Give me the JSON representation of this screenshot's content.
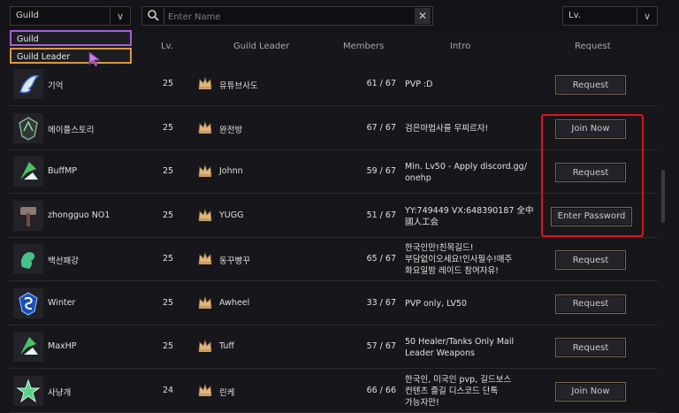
{
  "filter": {
    "selected": "Guild",
    "options": [
      "Guild",
      "Guild Leader"
    ]
  },
  "search": {
    "placeholder": "Enter Name"
  },
  "level_select": {
    "selected": "Lv."
  },
  "columns": {
    "lv": "Lv.",
    "leader": "Guild Leader",
    "members": "Members",
    "intro": "Intro",
    "request": "Request"
  },
  "rows": [
    {
      "name": "기억",
      "lv": "25",
      "leader": "유튜브사도",
      "members": "61 / 67",
      "intro": [
        "PVP :D"
      ],
      "button": "Request",
      "emblem": "dragon-emblem-icon"
    },
    {
      "name": "메이플스토리",
      "lv": "25",
      "leader": "완전방",
      "members": "67 / 67",
      "intro": [
        "검은마법사를 무찌르자!"
      ],
      "button": "Join Now",
      "emblem": "shield-emblem-icon"
    },
    {
      "name": "BuffMP",
      "lv": "25",
      "leader": "Johnn",
      "members": "59 / 67",
      "intro": [
        "Min. Lv50 - Apply discord.gg/",
        "onehp"
      ],
      "button": "Request",
      "emblem": "leaf-emblem-icon"
    },
    {
      "name": "zhongguo NO1",
      "lv": "25",
      "leader": "YUGG",
      "members": "51 / 67",
      "intro": [
        "YY:749449 VX:648390187 全中",
        "國人工会"
      ],
      "button": "Enter Password",
      "emblem": "hammer-emblem-icon"
    },
    {
      "name": "백선패강",
      "lv": "25",
      "leader": "동꾸빵꾸",
      "members": "65 / 67",
      "intro": [
        "한국인만!친목길드!",
        "부담없이오세요!인사필수!매주",
        "화요일밤 레이드 참여자유!"
      ],
      "button": "Request",
      "emblem": "swirl-emblem-icon"
    },
    {
      "name": "Winter",
      "lv": "25",
      "leader": "Awheel",
      "members": "33 / 67",
      "intro": [
        "PVP only, LV50"
      ],
      "button": "Request",
      "emblem": "blue-swirl-emblem-icon"
    },
    {
      "name": "MaxHP",
      "lv": "25",
      "leader": "Tuff",
      "members": "57 / 67",
      "intro": [
        "50 Healer/Tanks Only Mail",
        "Leader Weapons"
      ],
      "button": "Request",
      "emblem": "leaf-emblem-icon"
    },
    {
      "name": "사냥개",
      "lv": "24",
      "leader": "린케",
      "members": "66 / 66",
      "intro": [
        "한국인, 미국인 pvp, 길드보스",
        "컨텐츠 즐길 디스코드 단톡",
        "가능자만!"
      ],
      "button": "Join Now",
      "emblem": "star-emblem-icon"
    }
  ],
  "colors": {
    "highlight": "#e0121a",
    "dropdown_selected": "#a65ed6",
    "dropdown_hover": "#d79a43"
  }
}
